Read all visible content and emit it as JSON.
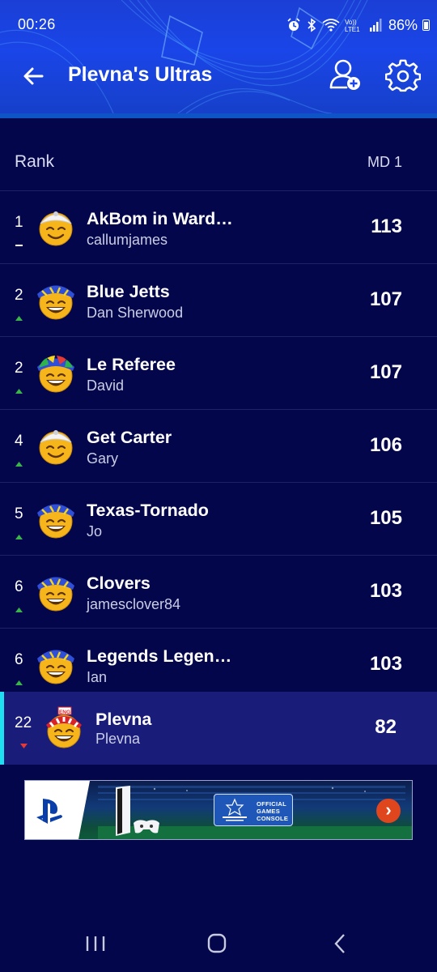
{
  "status_bar": {
    "time": "00:26",
    "battery": "86%"
  },
  "header": {
    "title": "Plevna's Ultras"
  },
  "list_header": {
    "rank_label": "Rank",
    "matchday_label": "MD 1"
  },
  "rows": [
    {
      "rank": "1",
      "trend": "same",
      "team": "AkBom in Ward…",
      "manager": "callumjames",
      "points": "113",
      "avatar": "plain-face-avatar"
    },
    {
      "rank": "2",
      "trend": "up",
      "team": "Blue Jetts",
      "manager": "Dan Sherwood",
      "points": "107",
      "avatar": "blue-hat-face-avatar"
    },
    {
      "rank": "2",
      "trend": "up",
      "team": "Le Referee",
      "manager": "David",
      "points": "107",
      "avatar": "multicolor-hat-face-avatar"
    },
    {
      "rank": "4",
      "trend": "up",
      "team": "Get Carter",
      "manager": "Gary",
      "points": "106",
      "avatar": "plain-face-avatar"
    },
    {
      "rank": "5",
      "trend": "up",
      "team": "Texas-Tornado",
      "manager": "Jo",
      "points": "105",
      "avatar": "blue-hat-face-avatar"
    },
    {
      "rank": "6",
      "trend": "up",
      "team": "Clovers",
      "manager": "jamesclover84",
      "points": "103",
      "avatar": "blue-hat-face-avatar"
    },
    {
      "rank": "6",
      "trend": "up",
      "team": "Legends Legen…",
      "manager": "Ian",
      "points": "103",
      "avatar": "blue-hat-face-avatar"
    }
  ],
  "my_team": {
    "rank": "22",
    "trend": "down",
    "team": "Plevna",
    "manager": "Plevna",
    "points": "82",
    "avatar_badge": "ENG"
  },
  "ad": {
    "badge_text": "OFFICIAL GAMES CONSOLE",
    "go_icon": "chevron-right-icon"
  },
  "colors": {
    "background": "#03064a",
    "header": "#1a45e8",
    "highlight_row": "#1a1c7a",
    "accent": "#1ee0f2",
    "up": "#39b54a",
    "down": "#e53935"
  }
}
